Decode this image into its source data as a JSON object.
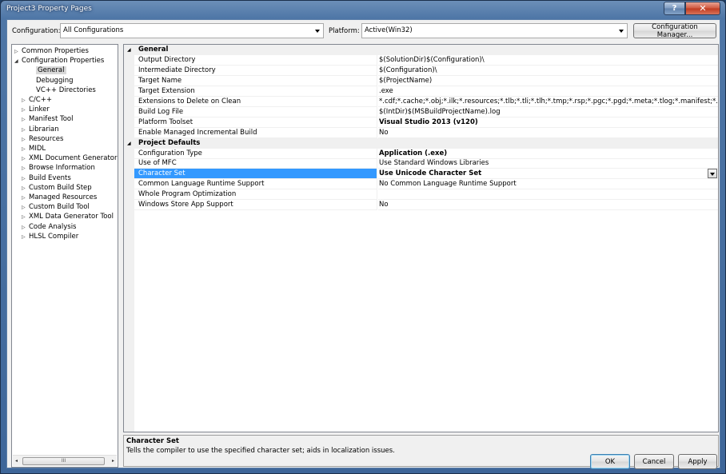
{
  "window": {
    "title": "Project3 Property Pages",
    "help_glyph": "?",
    "close_glyph": "✕"
  },
  "config": {
    "configuration_label": "Configuration:",
    "configuration_value": "All Configurations",
    "platform_label": "Platform:",
    "platform_value": "Active(Win32)",
    "manager_button": "Configuration Manager..."
  },
  "tree": [
    {
      "label": "Common Properties",
      "glyph": "▷",
      "indent": 0
    },
    {
      "label": "Configuration Properties",
      "glyph": "◢",
      "indent": 0
    },
    {
      "label": "General",
      "glyph": "",
      "indent": 2,
      "selected": true
    },
    {
      "label": "Debugging",
      "glyph": "",
      "indent": 2
    },
    {
      "label": "VC++ Directories",
      "glyph": "",
      "indent": 2
    },
    {
      "label": "C/C++",
      "glyph": "▷",
      "indent": 1
    },
    {
      "label": "Linker",
      "glyph": "▷",
      "indent": 1
    },
    {
      "label": "Manifest Tool",
      "glyph": "▷",
      "indent": 1
    },
    {
      "label": "Librarian",
      "glyph": "▷",
      "indent": 1
    },
    {
      "label": "Resources",
      "glyph": "▷",
      "indent": 1
    },
    {
      "label": "MIDL",
      "glyph": "▷",
      "indent": 1
    },
    {
      "label": "XML Document Generator",
      "glyph": "▷",
      "indent": 1
    },
    {
      "label": "Browse Information",
      "glyph": "▷",
      "indent": 1
    },
    {
      "label": "Build Events",
      "glyph": "▷",
      "indent": 1
    },
    {
      "label": "Custom Build Step",
      "glyph": "▷",
      "indent": 1
    },
    {
      "label": "Managed Resources",
      "glyph": "▷",
      "indent": 1
    },
    {
      "label": "Custom Build Tool",
      "glyph": "▷",
      "indent": 1
    },
    {
      "label": "XML Data Generator Tool",
      "glyph": "▷",
      "indent": 1
    },
    {
      "label": "Code Analysis",
      "glyph": "▷",
      "indent": 1
    },
    {
      "label": "HLSL Compiler",
      "glyph": "▷",
      "indent": 1
    }
  ],
  "tree_scroll": {
    "left": "◂",
    "right": "▸",
    "grip": "III"
  },
  "grid": [
    {
      "type": "category",
      "label": "General",
      "caret": "◢"
    },
    {
      "name": "Output Directory",
      "value": "$(SolutionDir)$(Configuration)\\"
    },
    {
      "name": "Intermediate Directory",
      "value": "$(Configuration)\\"
    },
    {
      "name": "Target Name",
      "value": "$(ProjectName)"
    },
    {
      "name": "Target Extension",
      "value": ".exe"
    },
    {
      "name": "Extensions to Delete on Clean",
      "value": "*.cdf;*.cache;*.obj;*.ilk;*.resources;*.tlb;*.tli;*.tlh;*.tmp;*.rsp;*.pgc;*.pgd;*.meta;*.tlog;*.manifest;*.res;*.pch;*.exp;*.idb;*.rep;*.xdc;*.pdb;*_manifest.rc;*.bsc;*.sbr;*.xml;*.metagen;*.bi"
    },
    {
      "name": "Build Log File",
      "value": "$(IntDir)$(MSBuildProjectName).log"
    },
    {
      "name": "Platform Toolset",
      "value": "Visual Studio 2013 (v120)",
      "bold": true
    },
    {
      "name": "Enable Managed Incremental Build",
      "value": "No"
    },
    {
      "type": "category",
      "label": "Project Defaults",
      "caret": "◢"
    },
    {
      "name": "Configuration Type",
      "value": "Application (.exe)",
      "bold": true
    },
    {
      "name": "Use of MFC",
      "value": "Use Standard Windows Libraries"
    },
    {
      "name": "Character Set",
      "value": "Use Unicode Character Set",
      "bold": true,
      "selected": true
    },
    {
      "name": "Common Language Runtime Support",
      "value": "No Common Language Runtime Support"
    },
    {
      "name": "Whole Program Optimization",
      "value": ""
    },
    {
      "name": "Windows Store App Support",
      "value": "No"
    }
  ],
  "description": {
    "title": "Character Set",
    "text": "Tells the compiler to use the specified character set; aids in localization issues."
  },
  "buttons": {
    "ok": "OK",
    "cancel": "Cancel",
    "apply": "Apply"
  }
}
